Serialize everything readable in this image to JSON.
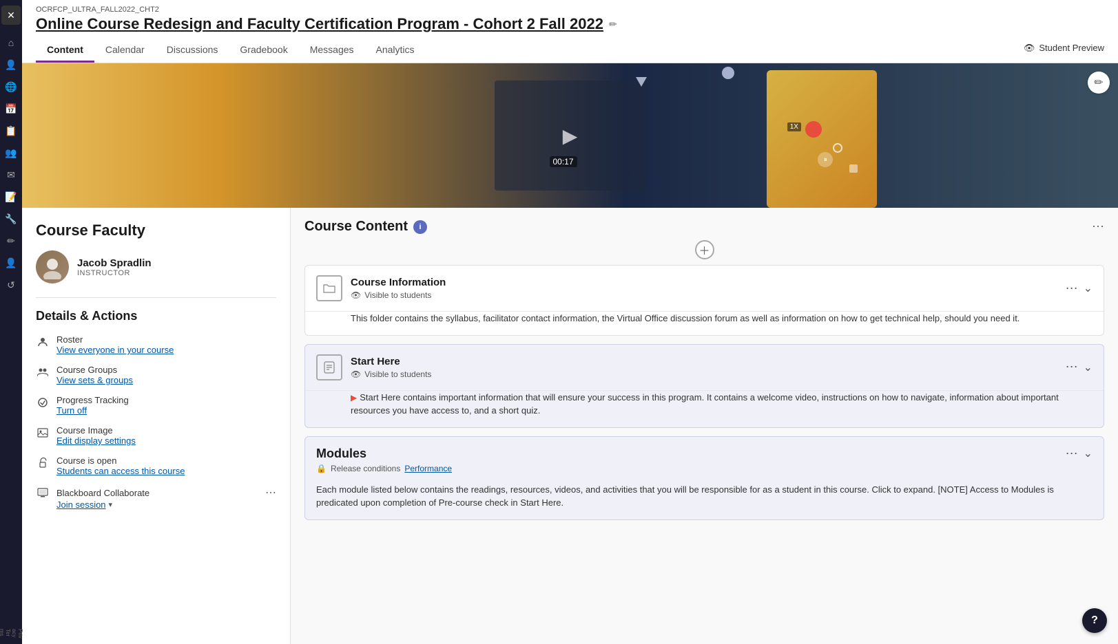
{
  "course": {
    "id": "OCRFCP_ULTRA_FALL2022_CHT2",
    "title": "Online Course Redesign and Faculty Certification Program - Cohort 2 Fall 2022"
  },
  "nav": {
    "tabs": [
      {
        "id": "content",
        "label": "Content",
        "active": true
      },
      {
        "id": "calendar",
        "label": "Calendar",
        "active": false
      },
      {
        "id": "discussions",
        "label": "Discussions",
        "active": false
      },
      {
        "id": "gradebook",
        "label": "Gradebook",
        "active": false
      },
      {
        "id": "messages",
        "label": "Messages",
        "active": false
      },
      {
        "id": "analytics",
        "label": "Analytics",
        "active": false
      }
    ],
    "student_preview": "Student Preview"
  },
  "faculty": {
    "section_title": "Course Faculty",
    "instructor": {
      "name": "Jacob Spradlin",
      "role": "INSTRUCTOR"
    }
  },
  "details": {
    "section_title": "Details & Actions",
    "items": [
      {
        "id": "roster",
        "label": "Roster",
        "link": "View everyone in your course"
      },
      {
        "id": "course-groups",
        "label": "Course Groups",
        "link": "View sets & groups"
      },
      {
        "id": "progress-tracking",
        "label": "Progress Tracking",
        "link": "Turn off"
      },
      {
        "id": "course-image",
        "label": "Course Image",
        "link": "Edit display settings"
      },
      {
        "id": "course-open",
        "label": "Course is open",
        "link": "Students can access this course"
      }
    ],
    "blackboard": {
      "label": "Blackboard Collaborate",
      "link": "Join session",
      "has_chevron": true
    }
  },
  "course_content": {
    "title": "Course Content",
    "info_icon": "i",
    "items": [
      {
        "id": "course-information",
        "name": "Course Information",
        "visibility": "Visible to students",
        "description": "This folder contains the syllabus, facilitator contact information, the Virtual Office discussion forum as well as information on how to get technical help, should you need it."
      },
      {
        "id": "start-here",
        "name": "Start Here",
        "visibility": "Visible to students",
        "description": "Start Here contains important information that will ensure your success in this program. It contains a welcome video, instructions on how to navigate, information about important resources you have access to, and a short quiz.",
        "has_flag": true
      },
      {
        "id": "modules",
        "name": "Modules",
        "visibility": null,
        "release_label": "Release conditions",
        "release_link": "Performance",
        "description": "Each module listed below contains the readings, resources, videos, and activities that you will be responsible for as a student in this course. Click to expand. [NOTE] Access to Modules is predicated upon completion of Pre-course check in Start Here."
      }
    ]
  }
}
